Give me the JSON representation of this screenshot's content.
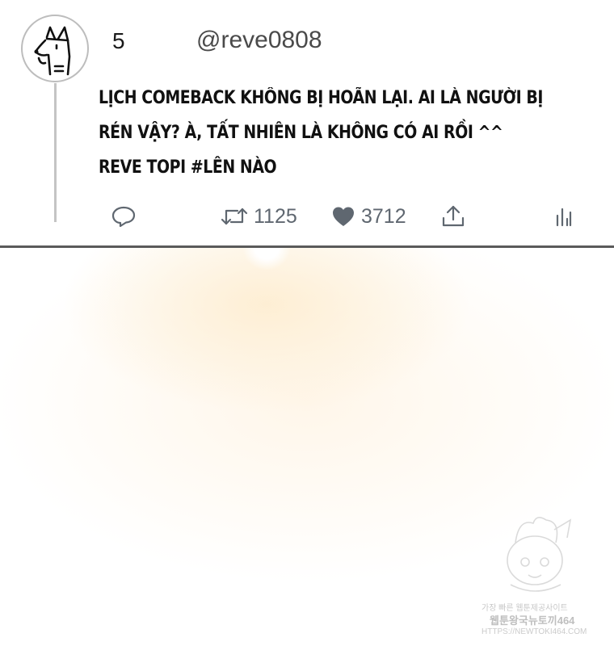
{
  "tweet": {
    "display_name": "5",
    "handle": "@reve0808",
    "text_lines": [
      "LỊCH COMEBACK KHÔNG BỊ HOÃN LẠI. AI LÀ NGƯỜI BỊ",
      "RÉN VẬY? À, TẤT NHIÊN LÀ KHÔNG CÓ AI RỒI ^^",
      "REVE TOPI #LÊN NÀO"
    ],
    "actions": {
      "reply_icon": "reply-icon",
      "retweet_icon": "retweet-icon",
      "retweet_count": "1125",
      "like_icon": "heart-icon",
      "like_count": "3712",
      "share_icon": "share-icon",
      "analytics_icon": "analytics-icon"
    }
  },
  "watermark": {
    "line1": "가장 빠른 웹툰제공사이트",
    "line2": "웹툰왕국뉴토끼464",
    "line3": "HTTPS://NEWTOKI464.COM"
  },
  "colors": {
    "action_gray": "#5f6770",
    "divider": "#5a5a5a",
    "thread_line": "#c4c4c4",
    "backdrop_tint": "#fdecce"
  }
}
